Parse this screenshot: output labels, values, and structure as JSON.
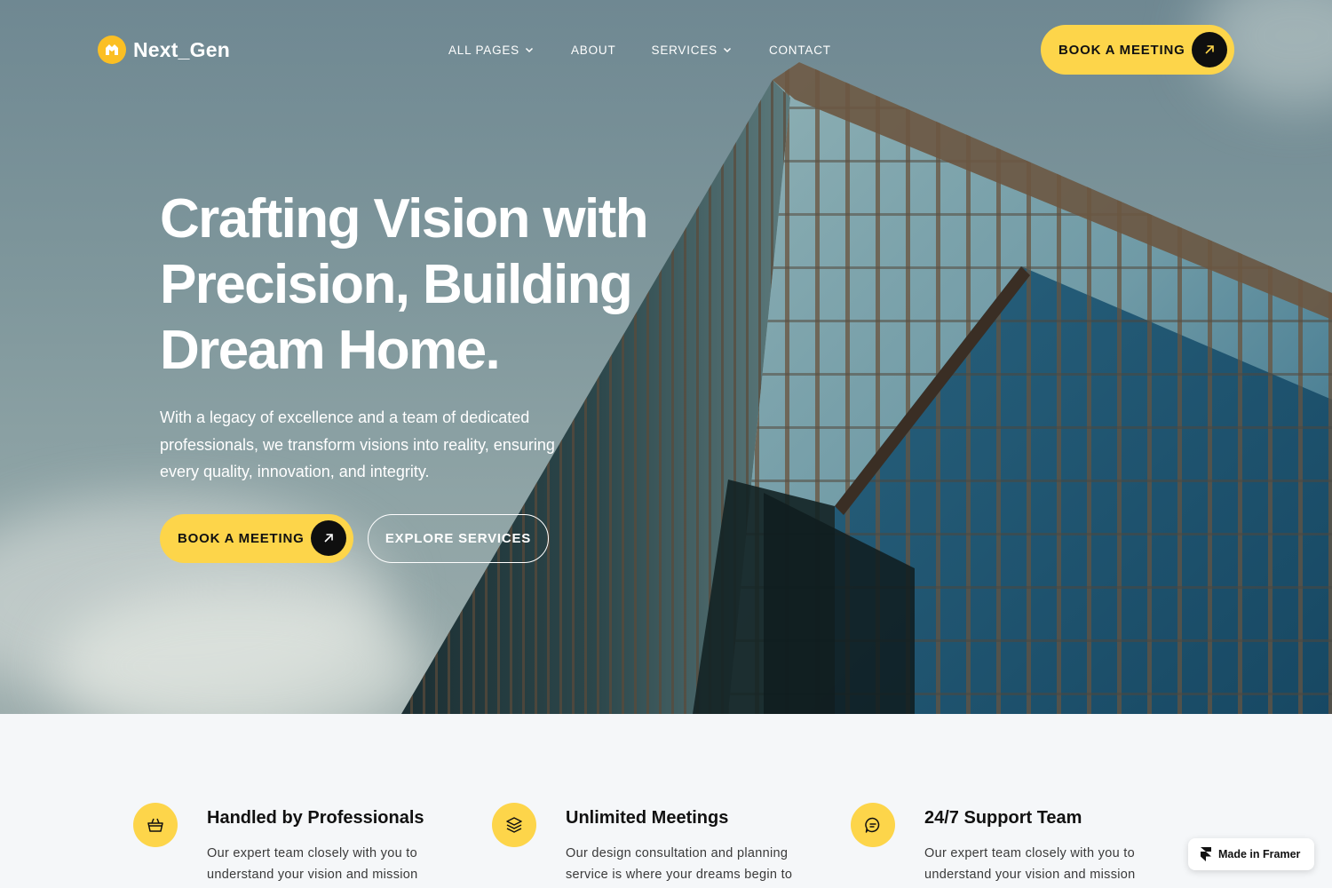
{
  "brand": {
    "name": "Next_Gen",
    "accent": "#fdd54a",
    "dark": "#0f0f0f"
  },
  "nav": {
    "items": [
      {
        "label": "ALL PAGES",
        "has_dropdown": true
      },
      {
        "label": "ABOUT",
        "has_dropdown": false
      },
      {
        "label": "SERVICES",
        "has_dropdown": true
      },
      {
        "label": "CONTACT",
        "has_dropdown": false
      }
    ],
    "cta_label": "BOOK A MEETING"
  },
  "hero": {
    "title_lines": [
      "Crafting Vision with",
      "Precision, Building",
      "Dream Home."
    ],
    "subtitle": "With a legacy of excellence and a team of dedicated professionals, we transform visions into reality, ensuring every quality, innovation, and integrity.",
    "primary_cta": "BOOK A MEETING",
    "secondary_cta": "EXPLORE SERVICES"
  },
  "features": [
    {
      "icon": "basket-icon",
      "title": "Handled by Professionals",
      "text": "Our expert team closely with you to understand your vision and mission"
    },
    {
      "icon": "layers-icon",
      "title": "Unlimited Meetings",
      "text": "Our design consultation and planning service is where your dreams begin to"
    },
    {
      "icon": "chat-icon",
      "title": "24/7 Support Team",
      "text": "Our expert team closely with you to understand your vision and mission"
    }
  ],
  "badge": {
    "label": "Made in Framer"
  }
}
